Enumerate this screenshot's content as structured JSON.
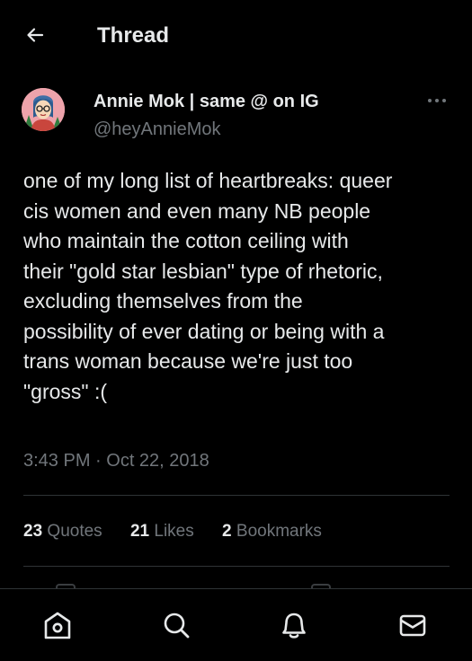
{
  "header": {
    "title": "Thread",
    "back_icon": "arrow-left-icon"
  },
  "tweet": {
    "author": {
      "name": "Annie Mok | same @ on IG",
      "handle": "@heyAnnieMok"
    },
    "text": "one of my long list of heartbreaks: queer\ncis women and even many NB people\nwho maintain the cotton ceiling with\ntheir \"gold star lesbian\" type of rhetoric,\nexcluding themselves from the\npossibility of ever dating or being with a\ntrans woman because we're just too\n\"gross\" :(",
    "time": "3:43 PM",
    "separator": " · ",
    "date": "Oct 22, 2018"
  },
  "stats": {
    "quotes": {
      "count": "23",
      "label": "Quotes"
    },
    "likes": {
      "count": "21",
      "label": "Likes"
    },
    "bookmarks": {
      "count": "2",
      "label": "Bookmarks"
    }
  },
  "bottom_nav": {
    "items": [
      {
        "icon": "home-icon"
      },
      {
        "icon": "search-icon"
      },
      {
        "icon": "notifications-bell-icon"
      },
      {
        "icon": "messages-envelope-icon"
      }
    ]
  },
  "colors": {
    "background": "#000000",
    "text_primary": "#e7e9ea",
    "text_secondary": "#71767b",
    "divider": "#2f3336"
  }
}
